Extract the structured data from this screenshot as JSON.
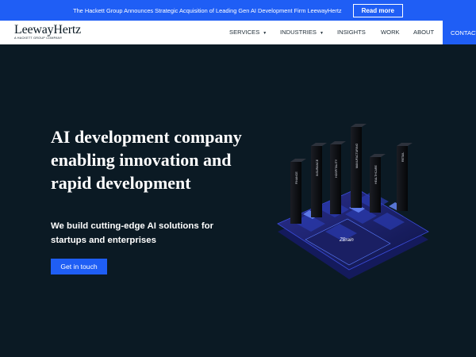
{
  "announcement": {
    "text": "The Hackett Group Announces Strategic Acquisition of Leading Gen AI Development Firm LeewayHertz",
    "button": "Read more"
  },
  "brand": {
    "name": "LeewayHertz",
    "tagline": "A HACKETT GROUP COMPANY"
  },
  "nav": {
    "items": [
      {
        "label": "SERVICES",
        "has_dropdown": true
      },
      {
        "label": "INDUSTRIES",
        "has_dropdown": true
      },
      {
        "label": "INSIGHTS",
        "has_dropdown": false
      },
      {
        "label": "WORK",
        "has_dropdown": false
      },
      {
        "label": "ABOUT",
        "has_dropdown": false
      }
    ],
    "contact": "CONTACT"
  },
  "hero": {
    "title": "AI development company enabling innovation and rapid development",
    "subtitle": "We build cutting-edge AI solutions for startups and enterprises",
    "cta": "Get in touch"
  },
  "illustration": {
    "bars": [
      "FINANCE",
      "INSURANCE",
      "HOSPITALITY",
      "MANUFACTURING",
      "HEALTHCARE",
      "RETAIL"
    ],
    "base_label": "ZBrain"
  },
  "colors": {
    "accent": "#1f5ef5",
    "background": "#0b1a24",
    "header_bg": "#ffffff"
  }
}
